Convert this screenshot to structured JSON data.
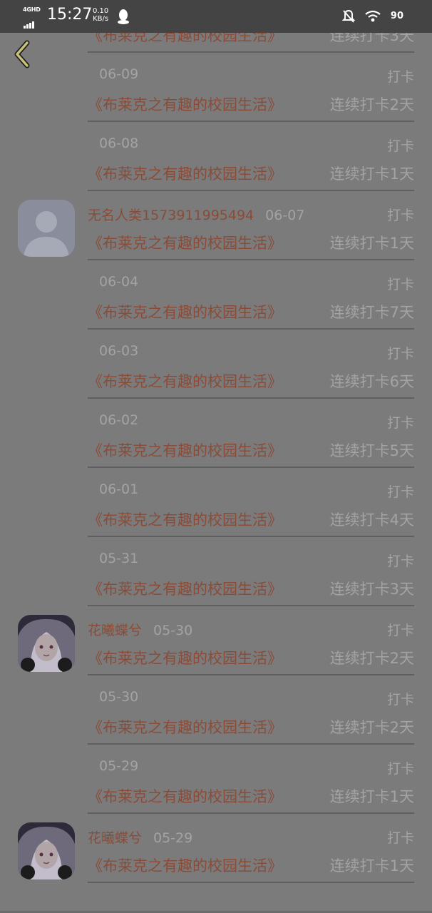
{
  "status_bar": {
    "network": "4GHD",
    "time": "15:27",
    "speed_value": "0.10",
    "speed_unit": "KB/s",
    "battery": "90"
  },
  "feed": [
    {
      "user": "",
      "date": "",
      "activity": "",
      "book": "《布莱克之有趣的校园生活》",
      "streak": "连续打卡3天"
    },
    {
      "user": "",
      "date": "06-09",
      "activity": "打卡",
      "book": "《布莱克之有趣的校园生活》",
      "streak": "连续打卡2天"
    },
    {
      "user": "",
      "date": "06-08",
      "activity": "打卡",
      "book": "《布莱克之有趣的校园生活》",
      "streak": "连续打卡1天"
    },
    {
      "user": "无名人类1573911995494",
      "avatar": "default-avatar-icon",
      "date": "06-07",
      "activity": "打卡",
      "book": "《布莱克之有趣的校园生活》",
      "streak": "连续打卡1天"
    },
    {
      "user": "",
      "date": "06-04",
      "activity": "打卡",
      "book": "《布莱克之有趣的校园生活》",
      "streak": "连续打卡7天"
    },
    {
      "user": "",
      "date": "06-03",
      "activity": "打卡",
      "book": "《布莱克之有趣的校园生活》",
      "streak": "连续打卡6天"
    },
    {
      "user": "",
      "date": "06-02",
      "activity": "打卡",
      "book": "《布莱克之有趣的校园生活》",
      "streak": "连续打卡5天"
    },
    {
      "user": "",
      "date": "06-01",
      "activity": "打卡",
      "book": "《布莱克之有趣的校园生活》",
      "streak": "连续打卡4天"
    },
    {
      "user": "",
      "date": "05-31",
      "activity": "打卡",
      "book": "《布莱克之有趣的校园生活》",
      "streak": "连续打卡3天"
    },
    {
      "user": "花曦蝶兮",
      "avatar": "anime-avatar-icon",
      "date": "05-30",
      "activity": "打卡",
      "book": "《布莱克之有趣的校园生活》",
      "streak": "连续打卡2天"
    },
    {
      "user": "",
      "date": "05-30",
      "activity": "打卡",
      "book": "《布莱克之有趣的校园生活》",
      "streak": "连续打卡2天"
    },
    {
      "user": "",
      "date": "05-29",
      "activity": "打卡",
      "book": "《布莱克之有趣的校园生活》",
      "streak": "连续打卡1天"
    },
    {
      "user": "花曦蝶兮",
      "avatar": "anime-avatar-icon",
      "date": "05-29",
      "activity": "打卡",
      "book": "《布莱克之有趣的校园生活》",
      "streak": "连续打卡1天"
    }
  ],
  "colors": {
    "overlay": "#7b7b7b",
    "status_bar": "#444444",
    "book_title": "#8a4c38",
    "muted_text": "#a3a3a3",
    "back_arrow": "#c7c47a"
  }
}
